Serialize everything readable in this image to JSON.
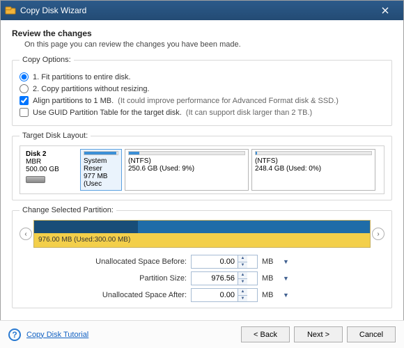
{
  "window": {
    "title": "Copy Disk Wizard"
  },
  "review": {
    "heading": "Review the changes",
    "sub": "On this page you can review the changes you have been made."
  },
  "copy_options": {
    "legend": "Copy Options:",
    "opt1": "1. Fit partitions to entire disk.",
    "opt2": "2. Copy partitions without resizing.",
    "align_label": "Align partitions to 1 MB.",
    "align_hint": "(It could improve performance for Advanced Format disk & SSD.)",
    "guid_label": "Use GUID Partition Table for the target disk.",
    "guid_hint": "(It can support disk larger than 2 TB.)",
    "selected_radio": 1,
    "align_checked": true,
    "guid_checked": false
  },
  "target_layout": {
    "legend": "Target Disk Layout:",
    "disk": {
      "name": "Disk 2",
      "type": "MBR",
      "size": "500.00 GB"
    },
    "parts": [
      {
        "title": "System Reser",
        "line2": "977 MB (Usec",
        "fill_pct": 95
      },
      {
        "title": "(NTFS)",
        "line2": "250.6 GB (Used: 9%)",
        "fill_pct": 9
      },
      {
        "title": "(NTFS)",
        "line2": "248.4 GB (Used: 0%)",
        "fill_pct": 1
      }
    ]
  },
  "change_partition": {
    "legend": "Change Selected Partition:",
    "bar_label": "976.00 MB (Used:300.00 MB)",
    "fields": {
      "before_label": "Unallocated Space Before:",
      "before_value": "0.00",
      "size_label": "Partition Size:",
      "size_value": "976.56",
      "after_label": "Unallocated Space After:",
      "after_value": "0.00",
      "unit": "MB"
    }
  },
  "footer": {
    "tutorial": "Copy Disk Tutorial",
    "back": "< Back",
    "next": "Next >",
    "cancel": "Cancel"
  }
}
